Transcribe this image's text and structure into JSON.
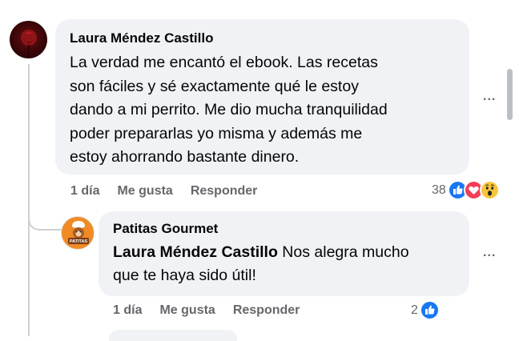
{
  "comment": {
    "author": "Laura Méndez Castillo",
    "text_lines": [
      "La verdad me encantó el ebook. Las recetas",
      "son fáciles y sé exactamente qué le estoy",
      "dando a mi perrito. Me dio mucha tranquilidad",
      "poder prepararlas yo misma y además me",
      "estoy ahorrando bastante dinero."
    ],
    "time": "1 día",
    "like_label": "Me gusta",
    "reply_label": "Responder",
    "reaction_count": "38",
    "reaction_icons": [
      "like-icon",
      "love-icon",
      "wow-icon"
    ],
    "more_label": "..."
  },
  "reply": {
    "author": "Patitas Gourmet",
    "avatar_label": "PATITAS",
    "mention": "Laura Méndez Castillo",
    "text_line1_rest": " Nos alegra mucho",
    "text_line2": "que te haya sido útil!",
    "time": "1 día",
    "like_label": "Me gusta",
    "reply_label": "Responder",
    "reaction_count": "2",
    "reaction_icons": [
      "like-icon"
    ],
    "more_label": "..."
  },
  "colors": {
    "bubble": "#f0f2f5",
    "secondary_text": "#65676b",
    "like": "#1877f2",
    "love": "#f33e58",
    "wow": "#f7c53b",
    "brand_avatar": "#f08a24"
  }
}
